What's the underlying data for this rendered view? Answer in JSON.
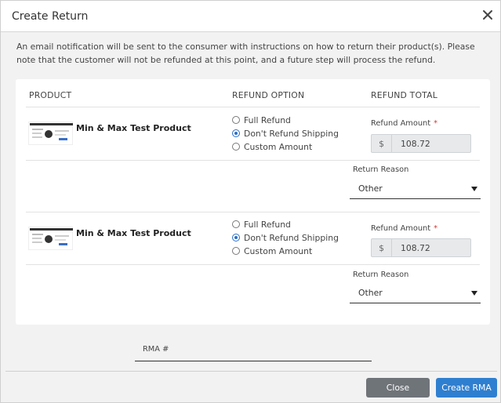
{
  "dialog": {
    "title": "Create Return",
    "notice": "An email notification will be sent to the consumer with instructions on how to return their product(s). Please note that the customer will not be refunded at this point, and a future step will process the refund."
  },
  "table": {
    "headers": {
      "product": "PRODUCT",
      "refund_option": "REFUND OPTION",
      "refund_total": "REFUND TOTAL"
    },
    "rows": [
      {
        "product_name": "Min & Max Test Product",
        "options": [
          "Full Refund",
          "Don't Refund Shipping",
          "Custom Amount"
        ],
        "selected_option": "Don't Refund Shipping",
        "amount_label": "Refund Amount",
        "required_marker": "*",
        "currency": "$",
        "amount": "108.72",
        "reason_label": "Return Reason",
        "reason": "Other"
      },
      {
        "product_name": "Min & Max Test Product",
        "options": [
          "Full Refund",
          "Don't Refund Shipping",
          "Custom Amount"
        ],
        "selected_option": "Don't Refund Shipping",
        "amount_label": "Refund Amount",
        "required_marker": "*",
        "currency": "$",
        "amount": "108.72",
        "reason_label": "Return Reason",
        "reason": "Other"
      }
    ]
  },
  "rma": {
    "label": "RMA #",
    "value": ""
  },
  "footer": {
    "close_label": "Close",
    "create_label": "Create RMA"
  },
  "colors": {
    "primary": "#2f7fd0",
    "secondary": "#6f7479",
    "required": "#d9342b"
  },
  "icons": {
    "close": "close-icon",
    "dropdown": "chevron-down-icon",
    "product_image": "product-thumbnail"
  }
}
